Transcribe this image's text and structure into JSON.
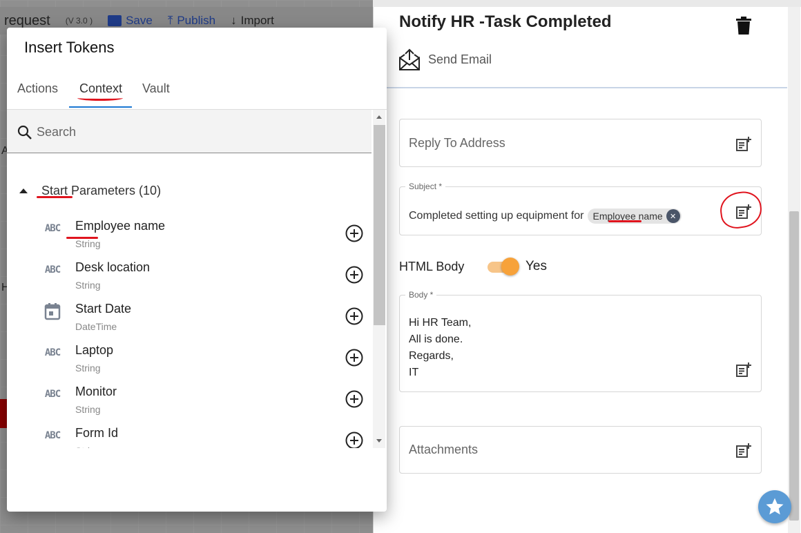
{
  "background": {
    "title": "request",
    "version": "(V 3.0 )",
    "save_label": "Save",
    "publish_label": "Publish",
    "import_label": "Import",
    "side_letters": [
      "A",
      "H"
    ]
  },
  "pane": {
    "title": "Notify HR -Task Completed",
    "action_label": "Send Email",
    "reply_to_placeholder": "Reply To Address",
    "subject_label": "Subject *",
    "subject_text": "Completed setting up equipment for",
    "subject_chip": "Employee name",
    "html_body_label": "HTML Body",
    "html_body_value": "Yes",
    "body_label": "Body *",
    "body_lines": [
      "Hi HR Team,",
      "All is done.",
      "Regards,",
      "IT"
    ],
    "attachments_placeholder": "Attachments"
  },
  "dialog": {
    "title": "Insert Tokens",
    "tabs": [
      "Actions",
      "Context",
      "Vault"
    ],
    "active_tab": "Context",
    "search_placeholder": "Search",
    "group_label": "Start Parameters (10)",
    "items": [
      {
        "name": "Employee name",
        "type": "String",
        "icon": "abc-icon"
      },
      {
        "name": "Desk location",
        "type": "String",
        "icon": "abc-icon"
      },
      {
        "name": "Start Date",
        "type": "DateTime",
        "icon": "calendar-icon"
      },
      {
        "name": "Laptop",
        "type": "String",
        "icon": "abc-icon"
      },
      {
        "name": "Monitor",
        "type": "String",
        "icon": "abc-icon"
      },
      {
        "name": "Form Id",
        "type": "String",
        "icon": "abc-icon"
      }
    ],
    "abc_glyph": "ABC"
  },
  "colors": {
    "accent": "#1976d2",
    "toggle": "#f7a23a",
    "annotation": "#e0141e",
    "fab": "#5b9bd5"
  }
}
